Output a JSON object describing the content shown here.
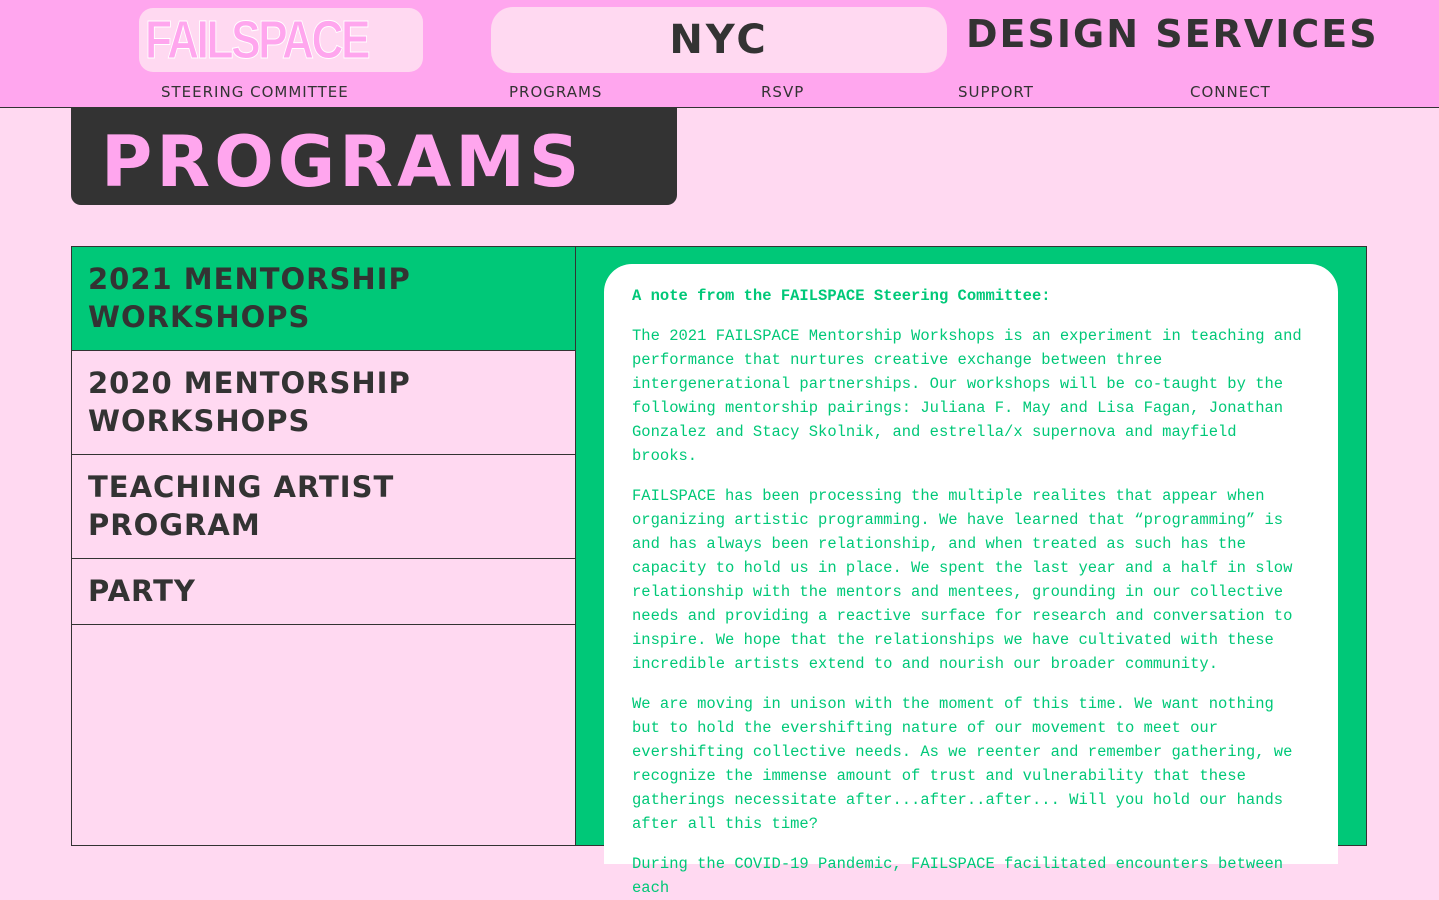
{
  "brand": {
    "logo_text": "FAILSPACE",
    "city": "NYC",
    "tagline": "DESIGN SERVICES"
  },
  "nav": [
    {
      "label": "STEERING COMMITTEE"
    },
    {
      "label": "PROGRAMS"
    },
    {
      "label": "RSVP"
    },
    {
      "label": "SUPPORT"
    },
    {
      "label": "CONNECT"
    }
  ],
  "page": {
    "title": "PROGRAMS"
  },
  "programs": [
    {
      "label": "2021 MENTORSHIP WORKSHOPS",
      "active": true
    },
    {
      "label": "2020 MENTORSHIP WORKSHOPS",
      "active": false
    },
    {
      "label": "TEACHING ARTIST PROGRAM",
      "active": false
    },
    {
      "label": "PARTY",
      "active": false
    }
  ],
  "note": {
    "heading": "A note from the FAILSPACE Steering Committee:",
    "paragraphs": [
      "The 2021 FAILSPACE Mentorship Workshops is an experiment in teaching and performance that nurtures creative exchange between three intergenerational partnerships. Our workshops will be co-taught by the following mentorship pairings: Juliana F. May and Lisa Fagan, Jonathan Gonzalez and Stacy Skolnik, and estrella/x supernova and mayfield brooks.",
      "FAILSPACE has been processing the multiple realites that appear when organizing artistic programming. We have learned that “programming” is and has always been relationship, and when treated as such has the capacity to hold us in place. We spent the last year and a half in slow relationship with the mentors and mentees, grounding in our collective needs and providing a reactive surface for research and conversation to inspire. We hope that the relationships we have cultivated with these incredible artists extend to and nourish our broader community.",
      "We are moving in unison with the moment of this time. We want nothing but to hold the evershifting nature of our movement to meet our evershifting collective needs. As we reenter and remember gathering, we recognize the immense amount of trust and vulnerability that these gatherings necessitate after...after..after... Will you hold our hands after all this time?",
      "During the COVID-19 Pandemic, FAILSPACE facilitated encounters between each"
    ]
  },
  "colors": {
    "header_bg": "#ffa6ee",
    "page_bg": "#ffd9f1",
    "accent_green": "#00c878",
    "dark": "#333333"
  },
  "icons": {
    "logo": "box-arrow-icon"
  }
}
